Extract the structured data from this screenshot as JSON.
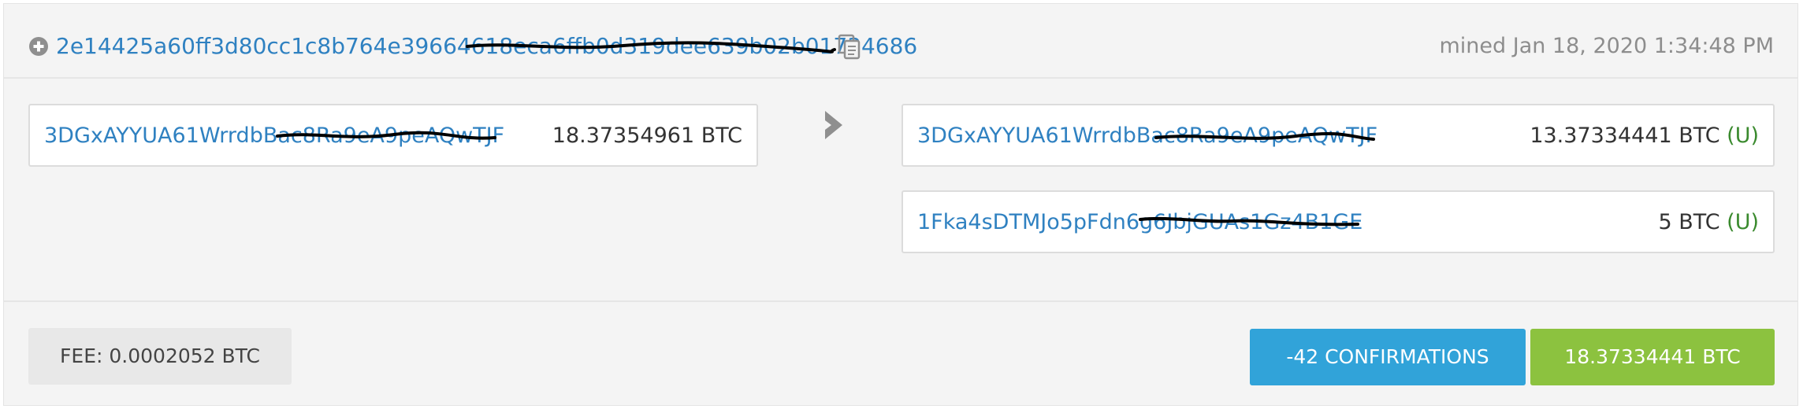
{
  "transaction": {
    "txid": "2e14425a60ff3d80cc1c8b764e39664618eca6ffb0d319dee639b02b01734686",
    "mined": "mined Jan 18, 2020 1:34:48 PM",
    "icons": {
      "expand": "plus-circle-icon",
      "copy": "copy-icon",
      "arrow": "chevron-right-icon"
    }
  },
  "inputs": [
    {
      "address": "3DGxAYYUA61WrrdbBac8Ra9eA9peAQwTJF",
      "amount": "18.37354961 BTC"
    }
  ],
  "outputs": [
    {
      "address": "3DGxAYYUA61WrrdbBac8Ra9eA9peAQwTJF",
      "amount": "13.37334441 BTC",
      "status": "(U)"
    },
    {
      "address": "1Fka4sDTMJo5pFdn6g6JbjGUAs1Gz4B1GE",
      "amount": "5 BTC",
      "status": "(U)"
    }
  ],
  "footer": {
    "fee": "FEE: 0.0002052 BTC",
    "confirmations": "-42 CONFIRMATIONS",
    "total": "18.37334441 BTC"
  },
  "colors": {
    "link": "#2f81c1",
    "unspent": "#3a8a2e",
    "confirmations_bg": "#31a3d9",
    "total_bg": "#8cc23f"
  }
}
